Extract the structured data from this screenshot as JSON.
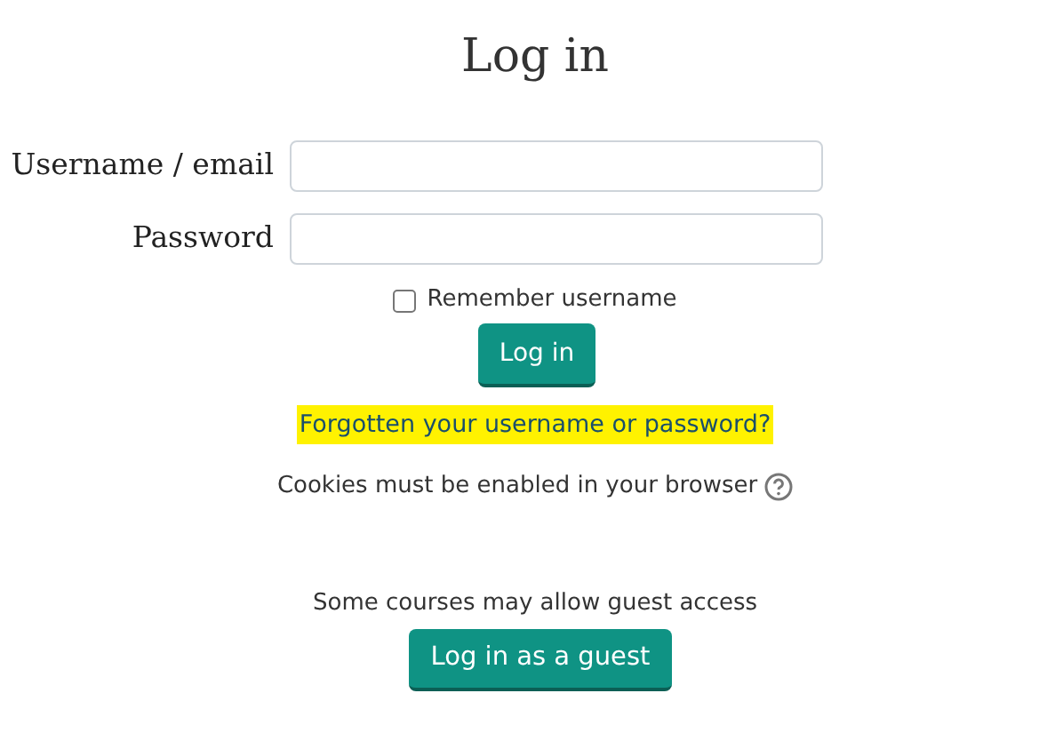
{
  "title": "Log in",
  "fields": [
    {
      "label": "Username / email"
    },
    {
      "label": "Password"
    }
  ],
  "remember": {
    "label": "Remember username",
    "checked": false
  },
  "login_button": "Log in",
  "forgot_link": "Forgotten your username or password?",
  "cookies_note": "Cookies must be enabled in your browser",
  "guest_note": "Some courses may allow guest access",
  "guest_button": "Log in as a guest"
}
